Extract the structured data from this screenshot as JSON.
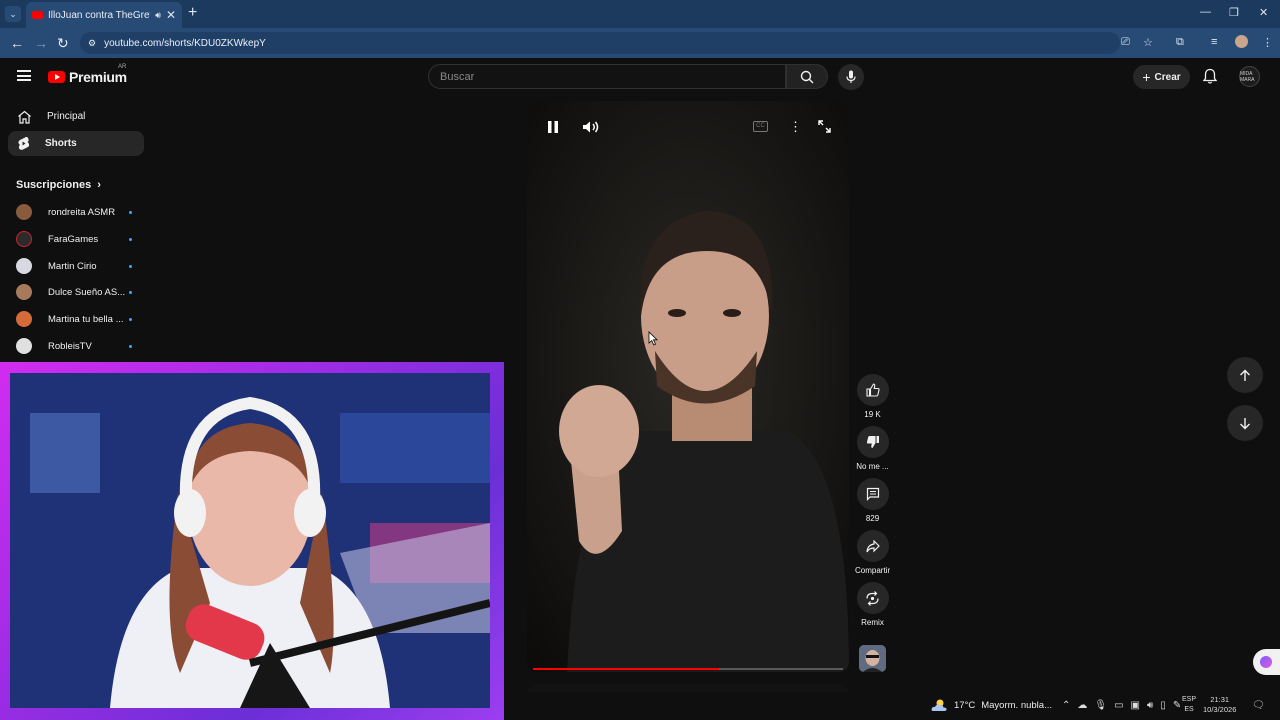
{
  "browser": {
    "tab_title": "IlloJuan contra TheGrefg en",
    "tab_close": "✕",
    "new_tab": "+",
    "url": "youtube.com/shorts/KDU0ZKWkepY"
  },
  "header": {
    "logo_text": "Premium",
    "logo_country": "AR",
    "search_placeholder": "Buscar",
    "create_label": "Crear",
    "avatar_text": "MIDA MARA"
  },
  "sidebar": {
    "items": [
      {
        "label": "Principal",
        "icon": "home-icon"
      },
      {
        "label": "Shorts",
        "icon": "shorts-icon",
        "active": true
      }
    ],
    "subscriptions_title": "Suscripciones",
    "subscriptions": [
      {
        "name": "rondreita ASMR",
        "color": "#8a5a3c"
      },
      {
        "name": "FaraGames",
        "color": "#2b2b2b"
      },
      {
        "name": "Martin Cirio",
        "color": "#d8d8e0"
      },
      {
        "name": "Dulce Sueño AS...",
        "color": "#a87a5c"
      },
      {
        "name": "Martina tu bella ...",
        "color": "#d56a3a"
      },
      {
        "name": "RobleisTV",
        "color": "#e0e0e0"
      }
    ]
  },
  "short": {
    "progress": 0.6
  },
  "actions": {
    "likes": "19 K",
    "dislike": "No me ...",
    "comments": "829",
    "share": "Compartir",
    "remix": "Remix"
  },
  "taskbar": {
    "temperature": "17°C",
    "weather": "Mayorm. nubla...",
    "lang_top": "ESP",
    "lang_bottom": "ES",
    "time": "21:31",
    "date": "10/3/2026"
  },
  "colors": {
    "accent": "#ff0000",
    "bg": "#0f0f0f",
    "chrome": "#274b75"
  }
}
